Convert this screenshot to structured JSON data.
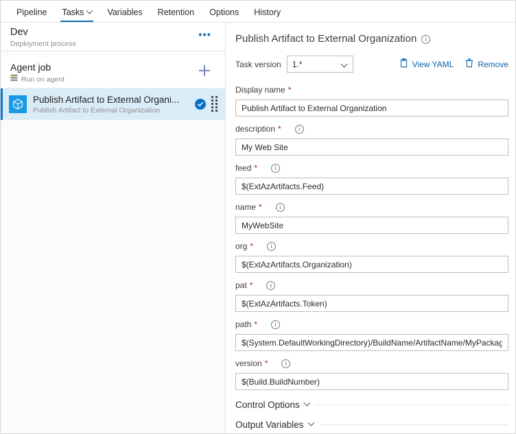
{
  "tabs": [
    {
      "label": "Pipeline",
      "active": false,
      "caret": false
    },
    {
      "label": "Tasks",
      "active": true,
      "caret": true
    },
    {
      "label": "Variables",
      "active": false,
      "caret": false
    },
    {
      "label": "Retention",
      "active": false,
      "caret": false
    },
    {
      "label": "Options",
      "active": false,
      "caret": false
    },
    {
      "label": "History",
      "active": false,
      "caret": false
    }
  ],
  "sidebar": {
    "process": {
      "title": "Dev",
      "subtitle": "Deployment process",
      "more_label": "•••"
    },
    "job": {
      "title": "Agent job",
      "subtitle": "Run on agent"
    },
    "task": {
      "name": "Publish Artifact to External Organi...",
      "description": "Publish Artifact to External Organization"
    }
  },
  "panel": {
    "title": "Publish Artifact to External Organization",
    "version_label": "Task version",
    "version_value": "1.*",
    "view_yaml_label": "View YAML",
    "remove_label": "Remove",
    "fields": [
      {
        "label": "Display name",
        "required": true,
        "info": false,
        "value": "Publish Artifact to External Organization",
        "placeholder": ""
      },
      {
        "label": "description",
        "required": true,
        "info": true,
        "value": "My Web Site",
        "placeholder": ""
      },
      {
        "label": "feed",
        "required": true,
        "info": true,
        "value": "$(ExtAzArtifacts.Feed)",
        "placeholder": ""
      },
      {
        "label": "name",
        "required": true,
        "info": true,
        "value": "MyWebSite",
        "placeholder": ""
      },
      {
        "label": "org",
        "required": true,
        "info": true,
        "value": "$(ExtAzArtifacts.Organization)",
        "placeholder": ""
      },
      {
        "label": "pat",
        "required": true,
        "info": true,
        "value": "$(ExtAzArtifacts.Token)",
        "placeholder": ""
      },
      {
        "label": "path",
        "required": true,
        "info": true,
        "value": "$(System.DefaultWorkingDirectory)/BuildName/ArtifactName/MyPackage.zip",
        "placeholder": ""
      },
      {
        "label": "version",
        "required": true,
        "info": true,
        "value": "$(Build.BuildNumber)",
        "placeholder": ""
      }
    ],
    "sections": [
      {
        "label": "Control Options"
      },
      {
        "label": "Output Variables"
      }
    ]
  },
  "colors": {
    "accent": "#0b6cb5",
    "link": "#0f62ab",
    "task_icon_bg": "#1a9ae3",
    "selected_row_bg": "#dbecf9",
    "required_asterisk": "#a4262c"
  }
}
